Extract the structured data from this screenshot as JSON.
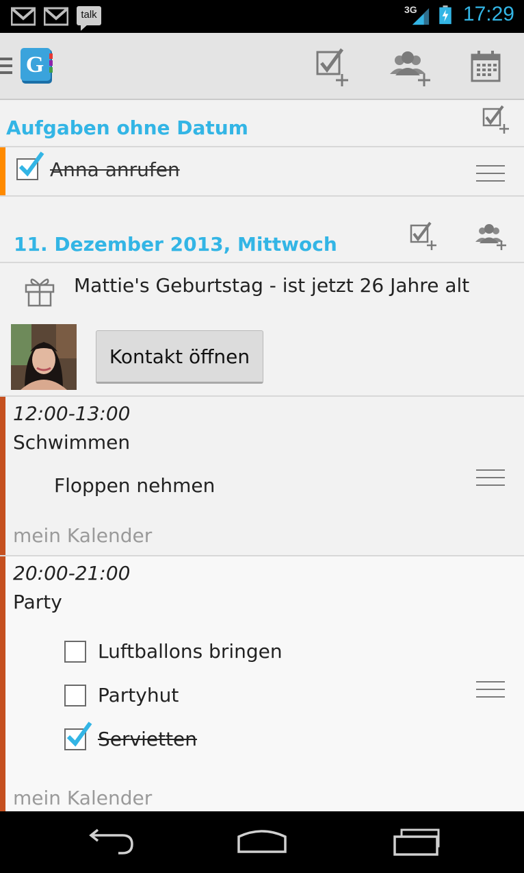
{
  "status_bar": {
    "time": "17:29",
    "talk_label": "talk",
    "network": "3G",
    "icons": [
      "gmail-icon",
      "gmail-icon",
      "talk-icon",
      "signal-icon",
      "battery-icon"
    ]
  },
  "action_bar": {
    "app_icon": "g-calendar-app-icon",
    "actions": [
      {
        "name": "add-task",
        "icon": "checkbox-plus-icon"
      },
      {
        "name": "add-contact-event",
        "icon": "people-plus-icon"
      },
      {
        "name": "calendar",
        "icon": "calendar-icon"
      }
    ]
  },
  "tasks_no_date": {
    "title": "Aufgaben ohne Datum",
    "items": [
      {
        "label": "Anna anrufen",
        "done": true
      }
    ]
  },
  "day": {
    "title": "11. Dezember 2013, Mittwoch",
    "birthday": {
      "text": "Mattie's Geburtstag - ist jetzt 26 Jahre alt",
      "button_label": "Kontakt öffnen"
    },
    "events": [
      {
        "time": "12:00-13:00",
        "title": "Schwimmen",
        "note": "Floppen nehmen",
        "calendar": "mein Kalender",
        "accent_color": "#c5501f"
      },
      {
        "time": "20:00-21:00",
        "title": "Party",
        "checklist": [
          {
            "label": "Luftballons bringen",
            "done": false
          },
          {
            "label": "Partyhut",
            "done": false
          },
          {
            "label": "Servietten",
            "done": true
          }
        ],
        "calendar": "mein Kalender",
        "accent_color": "#c5501f"
      }
    ]
  },
  "colors": {
    "accent_blue": "#33b5e5",
    "task_accent": "#ff8a00",
    "event_accent": "#c5501f"
  }
}
